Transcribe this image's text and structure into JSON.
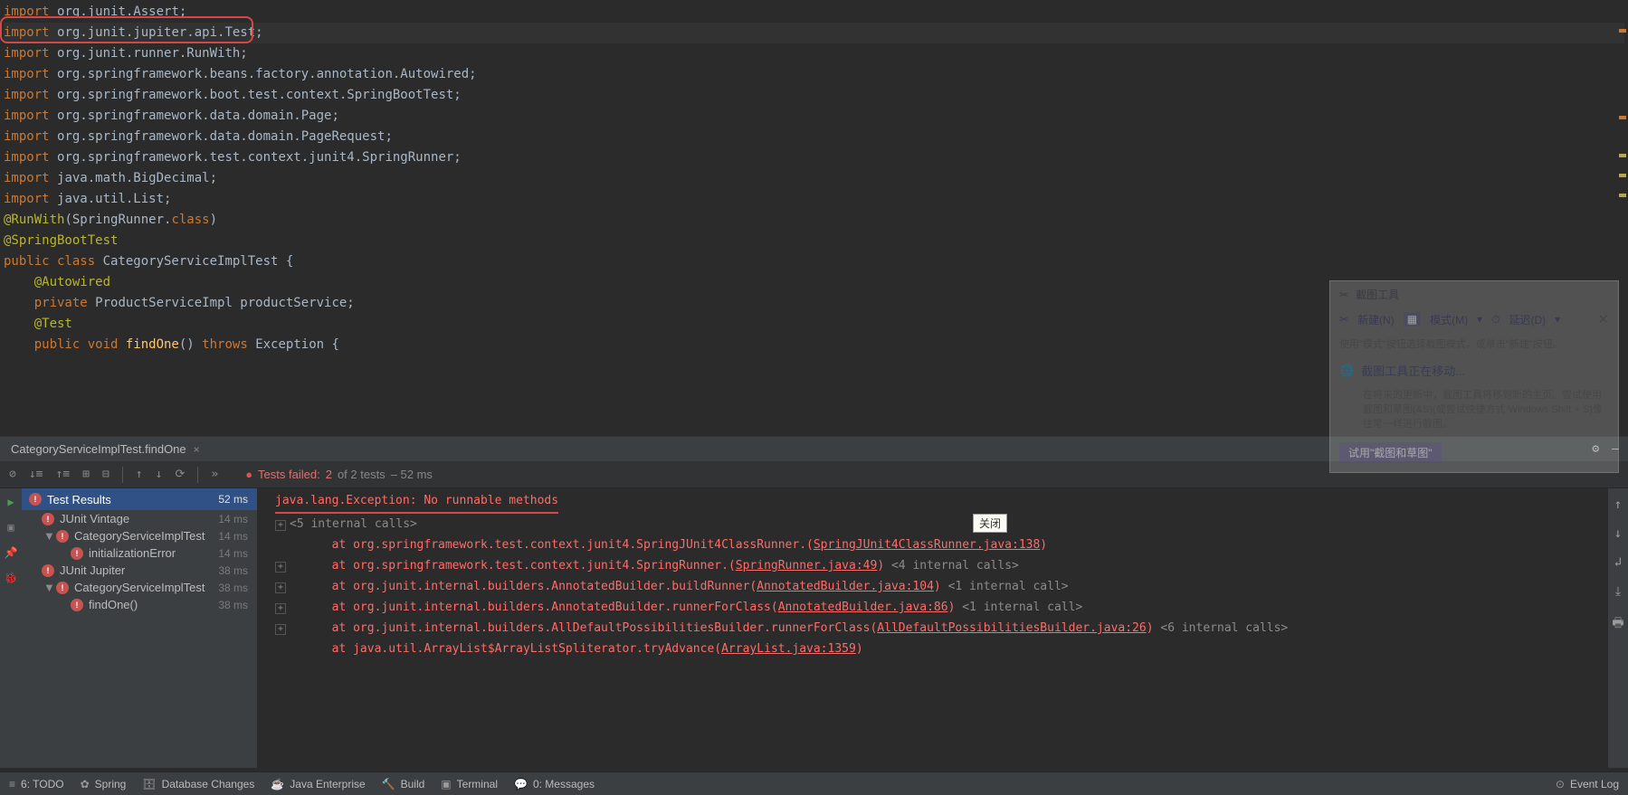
{
  "editor": {
    "lines": [
      [
        {
          "t": "import ",
          "c": "kw"
        },
        {
          "t": "org.junit.Assert;",
          "c": "pkg"
        }
      ],
      [
        {
          "t": "import ",
          "c": "kw"
        },
        {
          "t": "org.junit.jupiter.api.Test;",
          "c": "pkg"
        }
      ],
      [
        {
          "t": "import ",
          "c": "kw"
        },
        {
          "t": "org.junit.runner.RunWith;",
          "c": "pkg"
        }
      ],
      [
        {
          "t": "import ",
          "c": "kw"
        },
        {
          "t": "org.springframework.beans.factory.annotation.Autowired;",
          "c": "pkg"
        }
      ],
      [
        {
          "t": "import ",
          "c": "kw"
        },
        {
          "t": "org.springframework.boot.test.context.SpringBootTest;",
          "c": "pkg"
        }
      ],
      [
        {
          "t": "import ",
          "c": "kw"
        },
        {
          "t": "org.springframework.data.domain.Page;",
          "c": "pkg"
        }
      ],
      [
        {
          "t": "import ",
          "c": "kw"
        },
        {
          "t": "org.springframework.data.domain.PageRequest;",
          "c": "pkg"
        }
      ],
      [
        {
          "t": "import ",
          "c": "kw"
        },
        {
          "t": "org.springframework.test.context.junit4.SpringRunner;",
          "c": "pkg"
        }
      ],
      [
        {
          "t": "import ",
          "c": "kw"
        },
        {
          "t": "java.math.BigDecimal;",
          "c": "pkg"
        }
      ],
      [
        {
          "t": "import ",
          "c": "kw"
        },
        {
          "t": "java.util.List;",
          "c": "pkg"
        }
      ],
      [
        {
          "t": "",
          "c": "pkg"
        }
      ],
      [
        {
          "t": "@RunWith",
          "c": "ann"
        },
        {
          "t": "(SpringRunner.",
          "c": "paren"
        },
        {
          "t": "class",
          "c": "kw"
        },
        {
          "t": ")",
          "c": "paren"
        }
      ],
      [
        {
          "t": "@SpringBootTest",
          "c": "ann"
        }
      ],
      [
        {
          "t": "public class ",
          "c": "kw"
        },
        {
          "t": "CategoryServiceImplTest {",
          "c": "cls"
        }
      ],
      [
        {
          "t": "",
          "c": "pkg"
        }
      ],
      [
        {
          "t": "    @Autowired",
          "c": "ann"
        }
      ],
      [
        {
          "t": "    private ",
          "c": "kw"
        },
        {
          "t": "ProductServiceImpl productService;",
          "c": "cls"
        }
      ],
      [
        {
          "t": "",
          "c": "pkg"
        }
      ],
      [
        {
          "t": "    @Test",
          "c": "ann"
        }
      ],
      [
        {
          "t": "    public void ",
          "c": "kw"
        },
        {
          "t": "findOne",
          "c": "mth"
        },
        {
          "t": "() ",
          "c": "paren"
        },
        {
          "t": "throws ",
          "c": "kw"
        },
        {
          "t": "Exception {",
          "c": "cls"
        }
      ]
    ],
    "highlight_index": 1
  },
  "tab": {
    "label": "CategoryServiceImplTest.findOne"
  },
  "toolbar_status": {
    "prefix": "Tests failed: ",
    "redtext": "2",
    "midtext": " of 2 tests",
    "trail": " – 52 ms"
  },
  "results": {
    "header": {
      "label": "Test Results",
      "time": "52 ms"
    },
    "rows": [
      {
        "indent": 0,
        "tree": "",
        "icon": true,
        "label": "JUnit Vintage",
        "time": "14 ms"
      },
      {
        "indent": 1,
        "tree": "▼",
        "icon": true,
        "label": "CategoryServiceImplTest",
        "time": "14 ms"
      },
      {
        "indent": 2,
        "tree": "",
        "icon": true,
        "label": "initializationError",
        "time": "14 ms"
      },
      {
        "indent": 0,
        "tree": "",
        "icon": true,
        "label": "JUnit Jupiter",
        "time": "38 ms"
      },
      {
        "indent": 1,
        "tree": "▼",
        "icon": true,
        "label": "CategoryServiceImplTest",
        "time": "38 ms"
      },
      {
        "indent": 2,
        "tree": "",
        "icon": true,
        "label": "findOne()",
        "time": "38 ms"
      }
    ]
  },
  "console": {
    "exception_line": "java.lang.Exception: No runnable methods",
    "internal1": "<5 internal calls>",
    "lines": [
      {
        "lead": "\tat ",
        "pkg": "org.springframework.test.context.junit4.SpringJUnit4ClassRunner.<init>(",
        "link": "SpringJUnit4ClassRunner.java:138",
        "tail": ")",
        "extra": ""
      },
      {
        "lead": "\tat ",
        "pkg": "org.springframework.test.context.junit4.SpringRunner.<init>(",
        "link": "SpringRunner.java:49",
        "tail": ") ",
        "extra": "<4 internal calls>"
      },
      {
        "lead": "\tat ",
        "pkg": "org.junit.internal.builders.AnnotatedBuilder.buildRunner(",
        "link": "AnnotatedBuilder.java:104",
        "tail": ") ",
        "extra": "<1 internal call>"
      },
      {
        "lead": "\tat ",
        "pkg": "org.junit.internal.builders.AnnotatedBuilder.runnerForClass(",
        "link": "AnnotatedBuilder.java:86",
        "tail": ") ",
        "extra": "<1 internal call>"
      },
      {
        "lead": "\tat ",
        "pkg": "org.junit.internal.builders.AllDefaultPossibilitiesBuilder.runnerForClass(",
        "link": "AllDefaultPossibilitiesBuilder.java:26",
        "tail": ") ",
        "extra": "<6 internal calls>"
      },
      {
        "lead": "\tat ",
        "pkg": "java.util.ArrayList$ArrayListSpliterator.tryAdvance(",
        "link": "ArrayList.java:1359",
        "tail": ")",
        "extra": ""
      }
    ]
  },
  "statusbar": {
    "items": [
      {
        "icon": "≡",
        "label": "6: TODO"
      },
      {
        "icon": "✿",
        "label": "Spring"
      },
      {
        "icon": "🗄",
        "label": "Database Changes"
      },
      {
        "icon": "☕",
        "label": "Java Enterprise"
      },
      {
        "icon": "🔨",
        "label": "Build"
      },
      {
        "icon": "▣",
        "label": "Terminal"
      },
      {
        "icon": "💬",
        "label": "0: Messages"
      }
    ],
    "right": {
      "icon": "⊙",
      "label": "Event Log"
    }
  },
  "tooltip": {
    "text": "关闭"
  },
  "snip": {
    "title": "截图工具",
    "new": "新建(N)",
    "mode": "模式(M)",
    "delay": "延迟(D)",
    "hint": "使用\"模式\"按钮选择截图模式，或单击\"新建\"按钮。",
    "move_title": "截图工具正在移动...",
    "move_body": "在将来的更新中，截图工具将移到新的主页。尝试使用截图和草图(&S)(或尝试快捷方式 Windows Shift + S)像往常一样进行截图。",
    "try_btn": "试用\"截图和草图\""
  }
}
